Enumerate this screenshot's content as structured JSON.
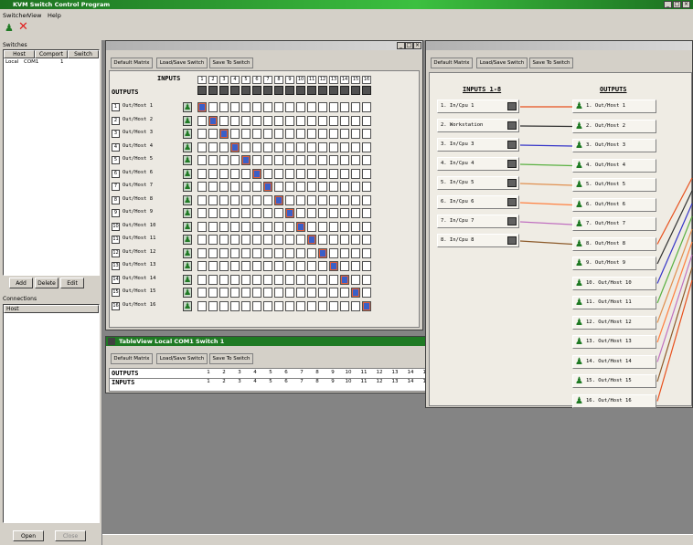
{
  "app": {
    "title": "KVM Switch Control Program",
    "menu": [
      "Switcher",
      "View",
      "Help"
    ]
  },
  "left": {
    "switches_label": "Switches",
    "cols": [
      "Host",
      "Comport",
      "Switch"
    ],
    "row": [
      "Local",
      "COM1",
      "1"
    ],
    "btns": [
      "Add",
      "Delete",
      "Edit"
    ],
    "connections_label": "Connections",
    "conn_col": "Host",
    "bottom_btns": [
      "Open",
      "Close"
    ]
  },
  "matrix": {
    "tabs": [
      "Default Matrix",
      "Load/Save Switch",
      "Save To Switch"
    ],
    "inputs_label": "INPUTS",
    "outputs_label": "OUTPUTS",
    "col_labels": [
      "1",
      "2",
      "3",
      "4",
      "5",
      "6",
      "7",
      "8",
      "9",
      "10",
      "11",
      "12",
      "13",
      "14",
      "15",
      "16"
    ],
    "rows": [
      "Out/Host 1",
      "Out/Host 2",
      "Out/Host 3",
      "Out/Host 4",
      "Out/Host 5",
      "Out/Host 6",
      "Out/Host 7",
      "Out/Host 8",
      "Out/Host 9",
      "Out/Host 10",
      "Out/Host 11",
      "Out/Host 12",
      "Out/Host 13",
      "Out/Host 14",
      "Out/Host 15",
      "Out/Host 16"
    ],
    "connections": [
      1,
      2,
      3,
      4,
      5,
      6,
      7,
      8,
      9,
      10,
      11,
      12,
      13,
      14,
      15,
      16
    ]
  },
  "table": {
    "title": "TableView Local COM1 Switch 1",
    "tabs": [
      "Default Matrix",
      "Load/Save Switch",
      "Save To Switch"
    ],
    "outputs_label": "OUTPUTS",
    "inputs_label": "INPUTS",
    "outputs": [
      "1",
      "2",
      "3",
      "4",
      "5",
      "6",
      "7",
      "8",
      "9",
      "10",
      "11",
      "12",
      "13",
      "14",
      "15",
      "16"
    ],
    "inputs": [
      "1",
      "2",
      "3",
      "4",
      "5",
      "6",
      "7",
      "8",
      "9",
      "10",
      "11",
      "12",
      "13",
      "14",
      "15",
      "16"
    ]
  },
  "graph": {
    "tabs": [
      "Default Matrix",
      "Load/Save Switch",
      "Save To Switch"
    ],
    "inputs_label": "INPUTS 1-8",
    "outputs_label": "OUTPUTS",
    "inputs": [
      "1. In/Cpu 1",
      "2. Workstation",
      "3. In/Cpu 3",
      "4. In/Cpu 4",
      "5. In/Cpu 5",
      "6. In/Cpu 6",
      "7. In/Cpu 7",
      "8. In/Cpu 8"
    ],
    "outputs": [
      "1. Out/Host 1",
      "2. Out/Host 2",
      "3. Out/Host 3",
      "4. Out/Host 4",
      "5. Out/Host 5",
      "6. Out/Host 6",
      "7. Out/Host 7",
      "8. Out/Host 8",
      "9. Out/Host 9",
      "10. Out/Host 10",
      "11. Out/Host 11",
      "12. Out/Host 12",
      "13. Out/Host 13",
      "14. Out/Host 14",
      "15. Out/Host 15",
      "16. Out/Host 16"
    ],
    "link_colors": [
      "#e8501c",
      "#303030",
      "#3434c8",
      "#58b040",
      "#e09050",
      "#ff8040",
      "#c070c0",
      "#8c5a2a"
    ]
  }
}
